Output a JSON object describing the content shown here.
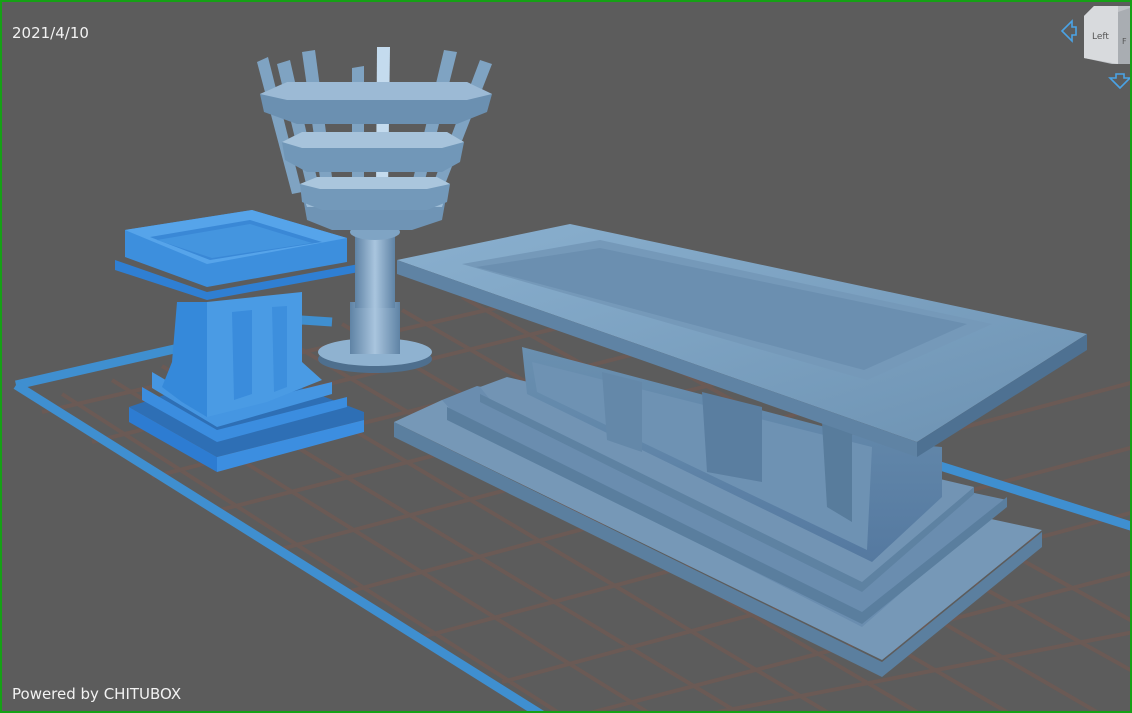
{
  "viewer": {
    "date": "2021/4/10",
    "powered_by": "Powered by CHITUBOX",
    "nav_cube": {
      "face_left": "Left",
      "face_front": "F"
    }
  },
  "colors": {
    "background": "#5c5c5c",
    "border": "#16a116",
    "grid_line": "#6b5a55",
    "plate_frame": "#3f8fd0",
    "model_selected": "#3f8fd6",
    "model_default": "#6e94b5"
  },
  "icons": {
    "rotate_left": "left-arrow-icon",
    "rotate_down": "down-arrow-icon",
    "view_cube": "view-cube-icon"
  }
}
